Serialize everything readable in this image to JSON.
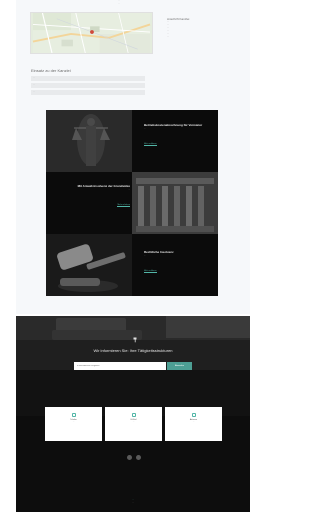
{
  "top": {
    "line1": "…",
    "line2": "…"
  },
  "map": {
    "alt": "Standortkarte"
  },
  "contact": {
    "title": "Anschrift Kanzlei",
    "lines": [
      "…",
      "…",
      "…",
      "…",
      "…",
      "…"
    ]
  },
  "form": {
    "title": "Einsatz zu der Kanzlei",
    "fields": [
      "…",
      "…",
      "…"
    ],
    "submit": ""
  },
  "tiles": [
    {
      "title": "Betriebskostenabrechnung für Vermieter",
      "text": "…",
      "link": "Mehr erfahren"
    },
    {
      "title": "Mit Anwalt-Insolvenz der Grundsätze",
      "text": "…",
      "link": "Mehr erfahren"
    },
    {
      "title": "Rechtliche Insolvenz",
      "text": "…",
      "link": "Mehr erfahren"
    }
  ],
  "newsletter": {
    "title": "Wir informieren Sie: Ihre Tätigkeitsstrukturen",
    "placeholder": "E-Mail-Adresse eingeben",
    "button": "Absenden"
  },
  "cards": [
    {
      "title": "Telefon",
      "text": "…"
    },
    {
      "title": "E-Mail",
      "text": "…"
    },
    {
      "title": "Adresse",
      "text": "…"
    }
  ],
  "footer": {
    "line1": "…",
    "line2": "…"
  },
  "colors": {
    "accent": "#52b6a7",
    "footer_bg": "#0d0d0d",
    "grid_bg": "#0b0b0b"
  }
}
